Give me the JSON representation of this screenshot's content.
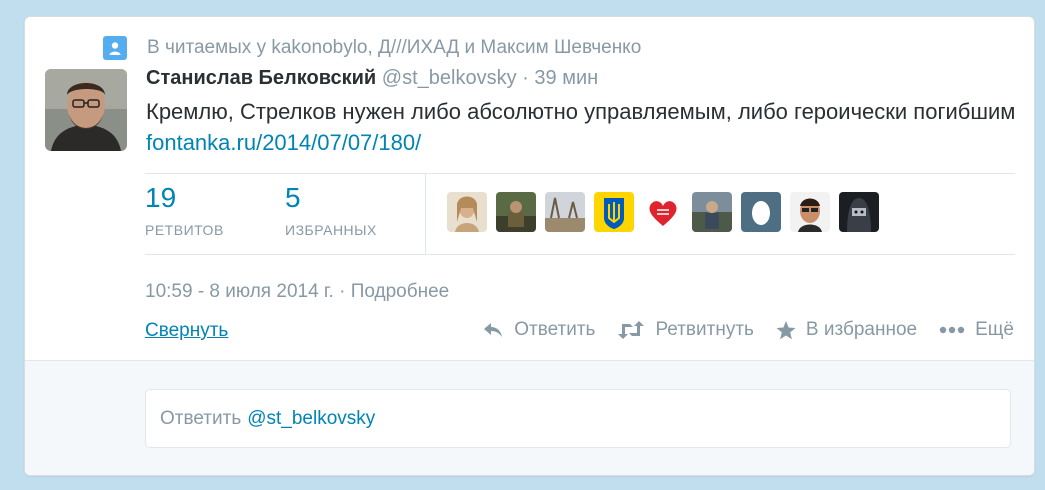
{
  "context": {
    "text": "В читаемых у kakonobylo, Д///ИХАД и Максим Шевченко",
    "icon": "user-icon"
  },
  "tweet": {
    "author_name": "Станислав Белковский",
    "author_handle": "@st_belkovsky",
    "separator": "·",
    "time_ago": "39 мин",
    "text": "Кремлю, Стрелков нужен либо абсолютно управляемым, либо героически погибшим",
    "link": "fontanka.ru/2014/07/07/180/"
  },
  "stats": {
    "retweets_count": "19",
    "retweets_label": "РЕТВИТОВ",
    "favorites_count": "5",
    "favorites_label": "ИЗБРАННЫХ",
    "favoriters": [
      "avatar-1",
      "avatar-2",
      "avatar-3",
      "avatar-ukraine-trident",
      "avatar-make-love-heart",
      "avatar-5",
      "avatar-egg",
      "avatar-7",
      "avatar-8"
    ]
  },
  "meta": {
    "timestamp": "10:59 - 8 июля 2014 г.",
    "separator": "·",
    "details_label": "Подробнее"
  },
  "actions": {
    "collapse_label": "Свернуть",
    "reply_label": "Ответить",
    "retweet_label": "Ретвитнуть",
    "favorite_label": "В избранное",
    "more_label": "Ещё"
  },
  "reply_box": {
    "prefix": "Ответить",
    "mention": "@st_belkovsky"
  },
  "colors": {
    "background": "#c0deed",
    "link": "#0084b4",
    "muted": "#8899a6",
    "text": "#292f33",
    "context_icon": "#55acee"
  }
}
